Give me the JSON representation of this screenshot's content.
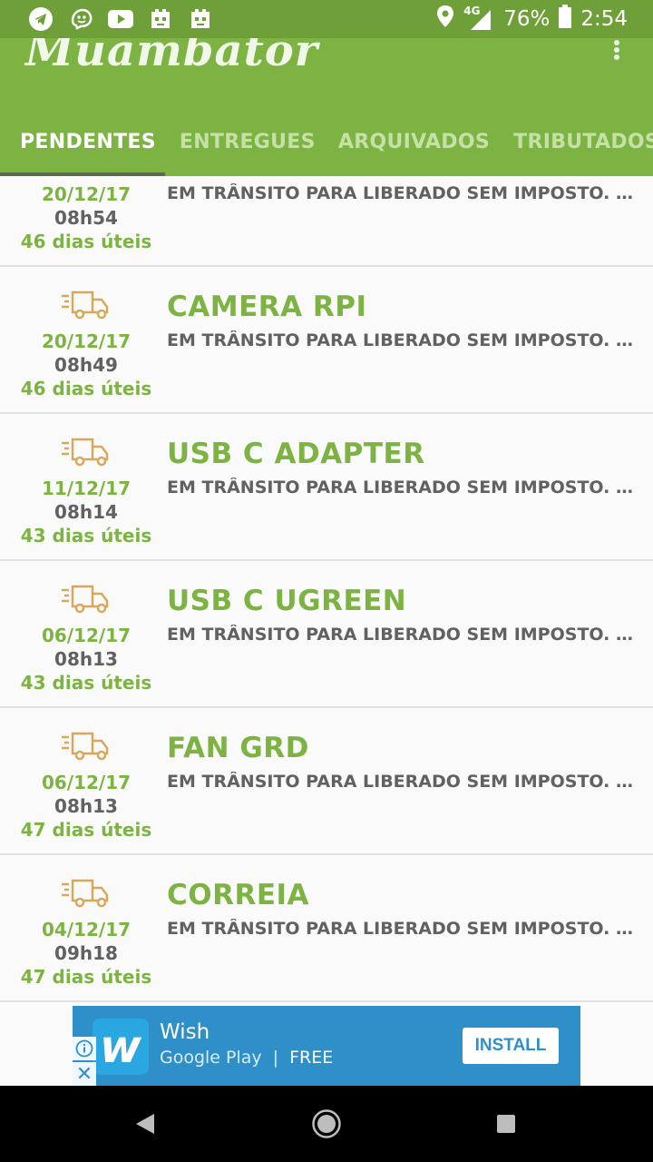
{
  "status_bar": {
    "network": "4G",
    "battery": "76%",
    "time": "2:54",
    "left_icons": [
      "telegram-icon",
      "waze-icon",
      "youtube-icon",
      "game-icon",
      "game-icon"
    ]
  },
  "app": {
    "logo_text": "Muambator",
    "overflow_icon": "more-vert-icon"
  },
  "tabs": [
    {
      "label": "PENDENTES",
      "active": true
    },
    {
      "label": "ENTREGUES",
      "active": false
    },
    {
      "label": "ARQUIVADOS",
      "active": false
    },
    {
      "label": "TRIBUTADOS",
      "active": false
    }
  ],
  "packages": [
    {
      "title": "",
      "date": "20/12/17",
      "time": "08h54",
      "days": "46 dias úteis",
      "status": "EM TRÂNSITO PARA LIBERADO SEM IMPOSTO. ENTREGA DA ENCOMENDA"
    },
    {
      "title": "CAMERA RPI",
      "date": "20/12/17",
      "time": "08h49",
      "days": "46 dias úteis",
      "status": "EM TRÂNSITO PARA LIBERADO SEM IMPOSTO. ENTREGA DA ENCOMENDA"
    },
    {
      "title": "USB C ADAPTER",
      "date": "11/12/17",
      "time": "08h14",
      "days": "43 dias úteis",
      "status": "EM TRÂNSITO PARA LIBERADO SEM IMPOSTO. ENTREGA DA ENCOMENDA"
    },
    {
      "title": "USB C UGREEN",
      "date": "06/12/17",
      "time": "08h13",
      "days": "43 dias úteis",
      "status": "EM TRÂNSITO PARA LIBERADO SEM IMPOSTO. ENTREGA DA ENCOMENDA"
    },
    {
      "title": "FAN GRD",
      "date": "06/12/17",
      "time": "08h13",
      "days": "47 dias úteis",
      "status": "EM TRÂNSITO PARA LIBERADO SEM IMPOSTO. ENTREGA DA ENCOMENDA"
    },
    {
      "title": "CORREIA",
      "date": "04/12/17",
      "time": "09h18",
      "days": "47 dias úteis",
      "status": "EM TRÂNSITO PARA LIBERADO SEM IMPOSTO. ENTREGA DA ENCOMENDA"
    }
  ],
  "ad": {
    "app_name": "Wish",
    "logo_letter": "w",
    "store": "Google Play",
    "separator": "|",
    "price": "FREE",
    "install_label": "INSTALL",
    "close_glyph": "✕"
  },
  "colors": {
    "primary": "#7cb342",
    "primary_dark": "#6e9f38",
    "truck": "#d8a85a",
    "ad_blue": "#2f8fc9"
  }
}
